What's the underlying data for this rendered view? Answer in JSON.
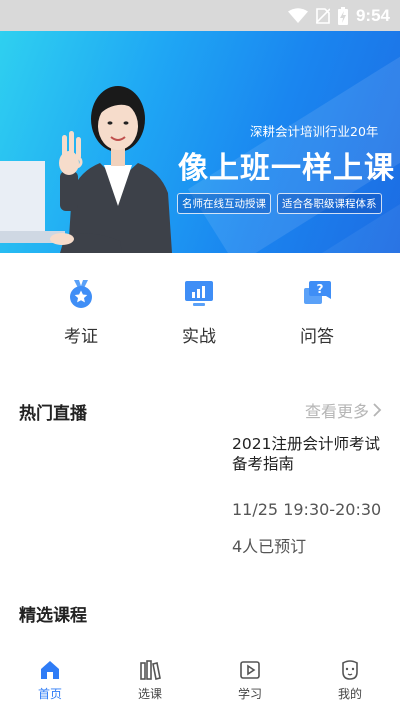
{
  "status_bar": {
    "time": "9:54"
  },
  "banner": {
    "subtitle": "深耕会计培训行业20年",
    "title": "像上班一样上课",
    "tags": [
      "名师在线互动授课",
      "适合各职级课程体系"
    ]
  },
  "quick_nav": [
    {
      "label": "考证",
      "icon": "medal-icon"
    },
    {
      "label": "实战",
      "icon": "monitor-chart-icon"
    },
    {
      "label": "问答",
      "icon": "question-chat-icon"
    }
  ],
  "hot_live": {
    "title": "热门直播",
    "more_label": "查看更多",
    "card": {
      "title": "2021注册会计师考试备考指南",
      "time": "11/25 19:30-20:30",
      "booked": "4人已预订"
    }
  },
  "featured": {
    "title": "精选课程"
  },
  "tab_bar": {
    "active": "首页",
    "items": [
      {
        "label": "首页",
        "icon": "home-icon"
      },
      {
        "label": "选课",
        "icon": "books-icon"
      },
      {
        "label": "学习",
        "icon": "video-icon"
      },
      {
        "label": "我的",
        "icon": "profile-icon"
      }
    ]
  },
  "colors": {
    "accent": "#2f7cf6",
    "banner_start": "#2fd0f0",
    "banner_end": "#1d6ce3",
    "muted": "#b5b5b5"
  }
}
